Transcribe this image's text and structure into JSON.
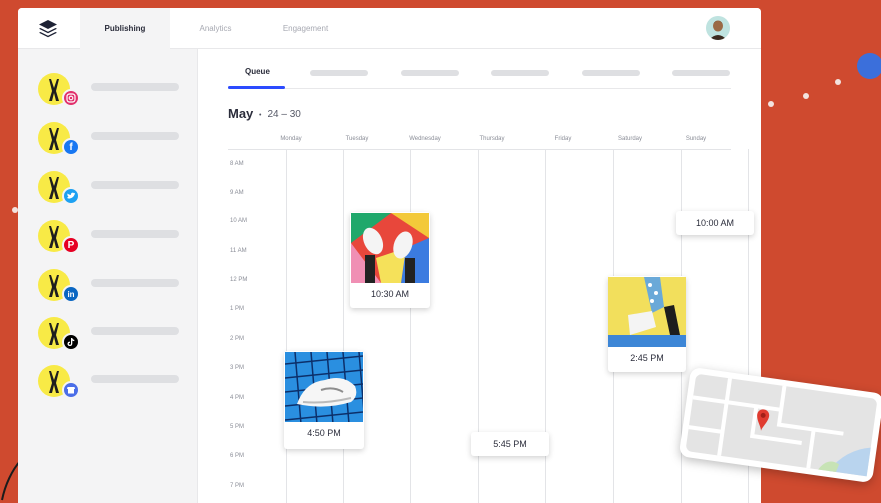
{
  "top_nav": {
    "tabs": [
      {
        "label": "Publishing",
        "active": true
      },
      {
        "label": "Analytics",
        "active": false
      },
      {
        "label": "Engagement",
        "active": false
      }
    ]
  },
  "sidebar": {
    "accounts": [
      {
        "network": "instagram-icon",
        "color": "#e1306c"
      },
      {
        "network": "facebook-icon",
        "color": "#1877f2"
      },
      {
        "network": "twitter-icon",
        "color": "#1da1f2"
      },
      {
        "network": "pinterest-icon",
        "color": "#e60023"
      },
      {
        "network": "linkedin-icon",
        "color": "#0a66c2"
      },
      {
        "network": "tiktok-icon",
        "color": "#000000"
      },
      {
        "network": "google-business-icon",
        "color": "#4b6ee8"
      }
    ]
  },
  "queue_tab": {
    "label": "Queue"
  },
  "calendar": {
    "month": "May",
    "separator": "•",
    "range": "24 – 30",
    "days": [
      "Monday",
      "Tuesday",
      "Wednesday",
      "Thursday",
      "Friday",
      "Saturday",
      "Sunday"
    ],
    "times": [
      "8 AM",
      "9 AM",
      "10 AM",
      "11 AM",
      "12 PM",
      "1 PM",
      "2 PM",
      "3 PM",
      "4 PM",
      "5 PM",
      "6 PM",
      "7 PM"
    ]
  },
  "posts": [
    {
      "time": "10:30 AM",
      "has_image": true
    },
    {
      "time": "10:00 AM",
      "has_image": false
    },
    {
      "time": "2:45 PM",
      "has_image": true
    },
    {
      "time": "4:50 PM",
      "has_image": true
    },
    {
      "time": "5:45 PM",
      "has_image": false
    }
  ],
  "colors": {
    "background": "#cf4a2f",
    "accent": "#2c4bff",
    "avatar_yellow": "#f8ea46"
  }
}
